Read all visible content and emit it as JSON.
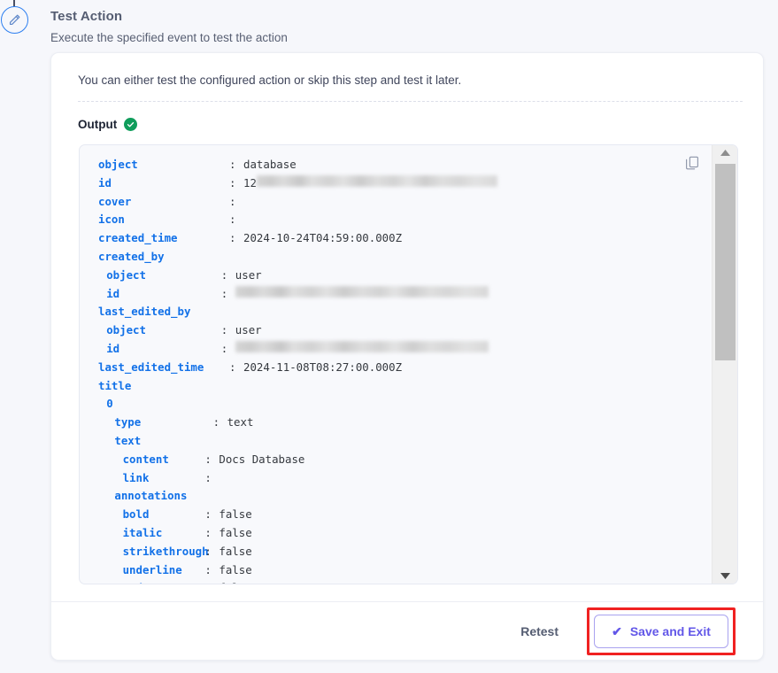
{
  "header": {
    "title": "Test Action",
    "subtitle": "Execute the specified event to test the action",
    "step_icon": "pencil-icon"
  },
  "card": {
    "intro_text": "You can either test the configured action or skip this step and test it later.",
    "output_label": "Output",
    "output_status": "success",
    "copy_icon": "copy-icon"
  },
  "output_json": {
    "colon": ":",
    "lines": [
      {
        "key": "object",
        "indent": 0,
        "value": "database",
        "has_colon": true
      },
      {
        "key": "id",
        "indent": 0,
        "value": "12",
        "has_colon": true,
        "redacted": true,
        "redact_width": 272
      },
      {
        "key": "cover",
        "indent": 0,
        "value": "",
        "has_colon": true
      },
      {
        "key": "icon",
        "indent": 0,
        "value": "",
        "has_colon": true
      },
      {
        "key": "created_time",
        "indent": 0,
        "value": "2024-10-24T04:59:00.000Z",
        "has_colon": true
      },
      {
        "key": "created_by",
        "indent": 0,
        "value": "",
        "has_colon": false
      },
      {
        "key": "object",
        "indent": 1,
        "value": "user",
        "has_colon": true
      },
      {
        "key": "id",
        "indent": 1,
        "value": "",
        "has_colon": true,
        "redacted": true,
        "redact_width": 286
      },
      {
        "key": "last_edited_by",
        "indent": 0,
        "value": "",
        "has_colon": false
      },
      {
        "key": "object",
        "indent": 1,
        "value": "user",
        "has_colon": true
      },
      {
        "key": "id",
        "indent": 1,
        "value": "",
        "has_colon": true,
        "redacted": true,
        "redact_width": 286
      },
      {
        "key": "last_edited_time",
        "indent": 0,
        "value": "2024-11-08T08:27:00.000Z",
        "has_colon": true
      },
      {
        "key": "title",
        "indent": 0,
        "value": "",
        "has_colon": false
      },
      {
        "key": "0",
        "indent": 1,
        "value": "",
        "has_colon": false
      },
      {
        "key": "type",
        "indent": 2,
        "value": "text",
        "has_colon": true
      },
      {
        "key": "text",
        "indent": 2,
        "value": "",
        "has_colon": false
      },
      {
        "key": "content",
        "indent": 3,
        "value": "Docs Database",
        "has_colon": true
      },
      {
        "key": "link",
        "indent": 3,
        "value": "",
        "has_colon": true
      },
      {
        "key": "annotations",
        "indent": 2,
        "value": "",
        "has_colon": false
      },
      {
        "key": "bold",
        "indent": 3,
        "value": "false",
        "has_colon": true
      },
      {
        "key": "italic",
        "indent": 3,
        "value": "false",
        "has_colon": true
      },
      {
        "key": "strikethrough",
        "indent": 3,
        "value": "false",
        "has_colon": true
      },
      {
        "key": "underline",
        "indent": 3,
        "value": "false",
        "has_colon": true
      },
      {
        "key": "code",
        "indent": 3,
        "value": "false",
        "has_colon": true
      }
    ]
  },
  "scrollbar": {
    "up_arrow_icon": "triangle-up-icon",
    "down_arrow_icon": "triangle-down-icon"
  },
  "footer": {
    "retest_label": "Retest",
    "save_exit_label": "Save and Exit",
    "save_exit_check_icon": "✔"
  },
  "colors": {
    "page_background": "#f6f7fb",
    "card_background": "#ffffff",
    "json_background": "#f8f9fc",
    "json_key": "#1271e8",
    "json_value": "#35393f",
    "accent_purple": "#6257e8",
    "highlight_red": "#f02121",
    "status_green": "#0f9d5b",
    "step_icon_blue": "#2d7ff0"
  }
}
